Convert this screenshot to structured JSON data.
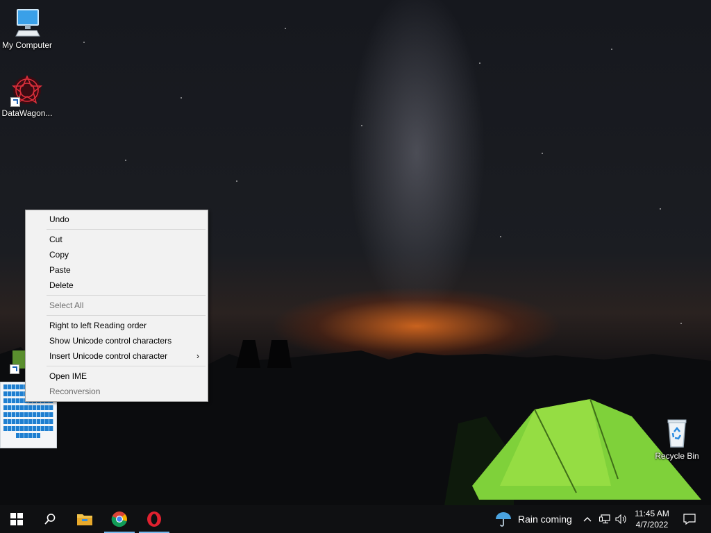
{
  "desktop": {
    "icons": [
      {
        "label": "My Computer",
        "icon": "computer-icon"
      },
      {
        "label": "DataWagon...",
        "icon": "datawagon-app-icon"
      },
      {
        "label": "Recycle Bin",
        "icon": "recycle-bin-icon"
      }
    ]
  },
  "context_menu": {
    "items": [
      {
        "label": "Undo",
        "enabled": true
      },
      {
        "label": "Cut",
        "enabled": true
      },
      {
        "label": "Copy",
        "enabled": true
      },
      {
        "label": "Paste",
        "enabled": true
      },
      {
        "label": "Delete",
        "enabled": true
      },
      {
        "label": "Select All",
        "enabled": false
      },
      {
        "label": "Right to left Reading order",
        "enabled": true
      },
      {
        "label": "Show Unicode control characters",
        "enabled": true
      },
      {
        "label": "Insert Unicode control character",
        "enabled": true,
        "submenu_icon": "chevron-right-icon"
      },
      {
        "label": "Open IME",
        "enabled": true
      },
      {
        "label": "Reconversion",
        "enabled": false
      }
    ]
  },
  "taskbar": {
    "start_icon": "windows-start-icon",
    "search_icon": "search-icon",
    "pinned": [
      {
        "name": "File Explorer",
        "icon": "file-explorer-icon"
      },
      {
        "name": "Google Chrome",
        "icon": "chrome-icon"
      },
      {
        "name": "Opera",
        "icon": "opera-icon"
      }
    ],
    "weather": {
      "icon": "umbrella-icon",
      "text": "Rain coming"
    },
    "tray_icons": [
      "chevron-up-icon",
      "network-icon",
      "volume-icon"
    ],
    "clock": {
      "time": "11:45 AM",
      "date": "4/7/2022"
    },
    "notification_icon": "action-center-icon"
  },
  "colors": {
    "taskbar_bg": "#0f1012",
    "active_indicator": "#76b9ed",
    "menu_bg": "#f2f2f2",
    "disabled_text": "#6d6d6d"
  }
}
